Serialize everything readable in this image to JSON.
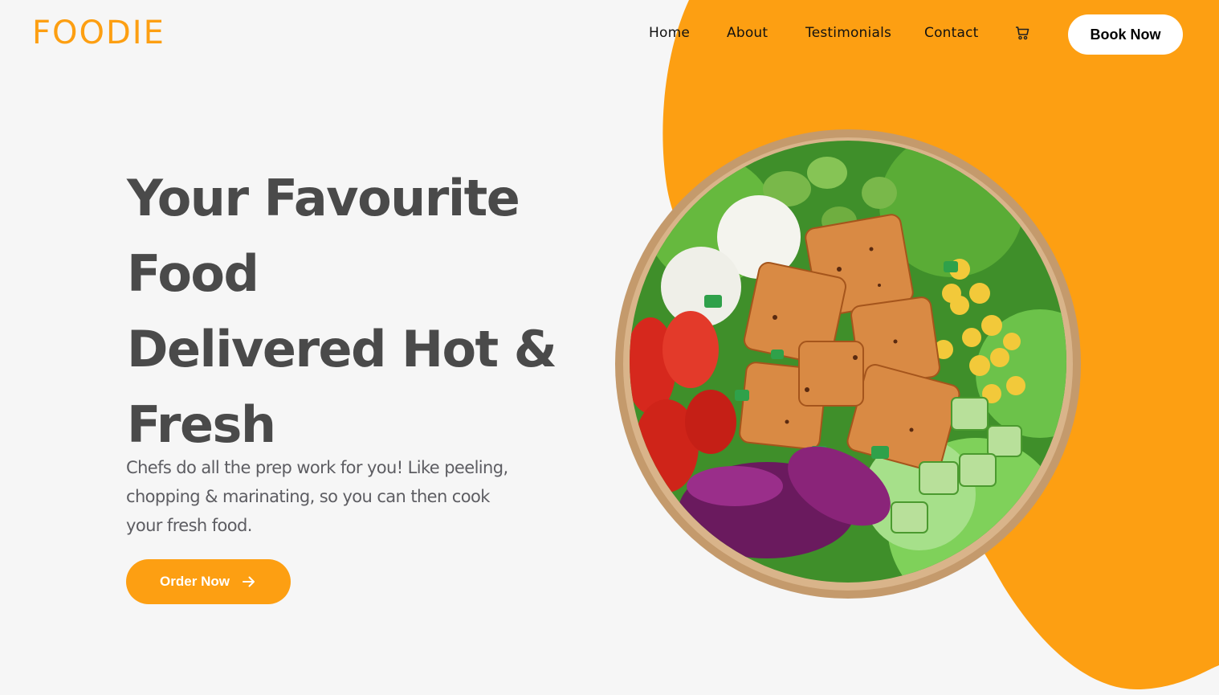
{
  "brand": {
    "logo_text": "FOODIE",
    "accent_color": "#fd9f12",
    "background_color": "#f6f6f6"
  },
  "nav": {
    "items": [
      {
        "label": "Home"
      },
      {
        "label": "About"
      },
      {
        "label": "Testimonials"
      },
      {
        "label": "Contact"
      }
    ],
    "cart_icon": "shopping-cart-icon",
    "book_button_label": "Book Now"
  },
  "hero": {
    "title_lines": [
      "Your Favourite Food",
      "Delivered Hot &",
      "Fresh"
    ],
    "description": "Chefs do all the prep work for you! Like peeling, chopping & marinating, so you can then cook your fresh food.",
    "cta_label": "Order Now",
    "cta_icon": "arrow-right-icon",
    "image_alt": "Salad bowl with tofu, eggs, edamame, corn, tomatoes, red cabbage, cucumber and lettuce"
  }
}
